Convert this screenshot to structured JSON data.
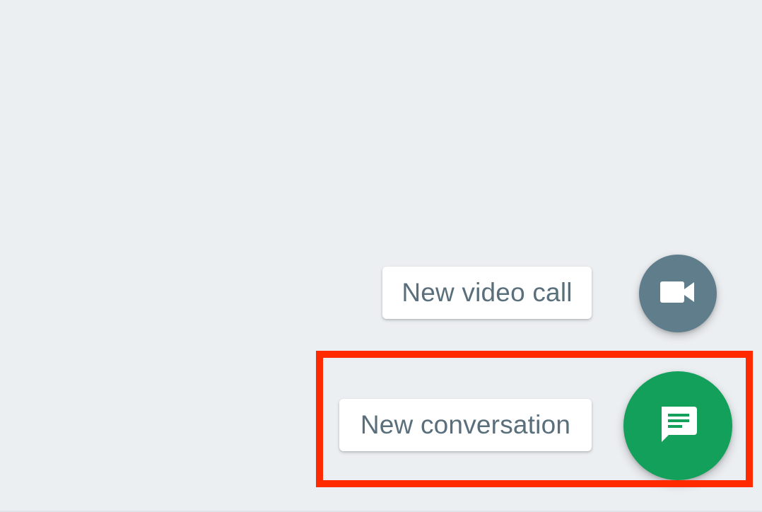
{
  "actions": {
    "video_call_label": "New video call",
    "conversation_label": "New conversation"
  },
  "icons": {
    "video_call": "video-camera-icon",
    "conversation": "chat-message-icon"
  },
  "colors": {
    "background": "#eceff2",
    "video_fab": "#607d8b",
    "conversation_fab": "#13a05a",
    "label_text": "#5a6f7c",
    "highlight": "#ff2a00"
  }
}
